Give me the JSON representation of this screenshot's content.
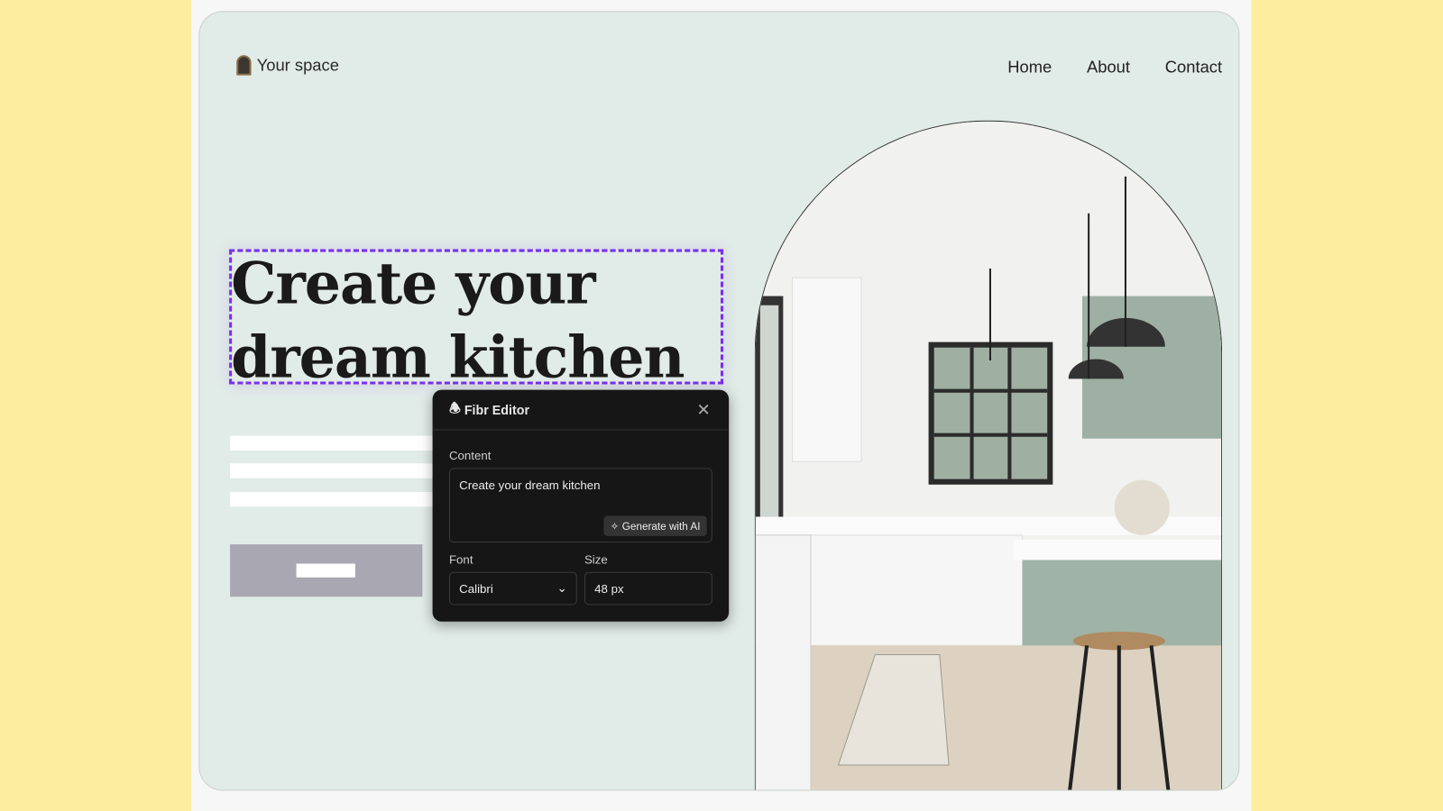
{
  "site": {
    "logo_text": "Your space",
    "nav": [
      "Home",
      "About",
      "Contact"
    ],
    "headline": [
      "Create your",
      "dream kitchen"
    ]
  },
  "editor": {
    "title": "Fibr Editor",
    "content_label": "Content",
    "content_value": "Create your dream kitchen",
    "generate_label": "Generate with AI",
    "font_label": "Font",
    "font_value": "Calibri",
    "size_label": "Size",
    "size_value": "48 px"
  },
  "colors": {
    "background": "#fdee9f",
    "site": "#e1ebe7",
    "selection": "#7b2ff0",
    "editor": "#161616"
  }
}
